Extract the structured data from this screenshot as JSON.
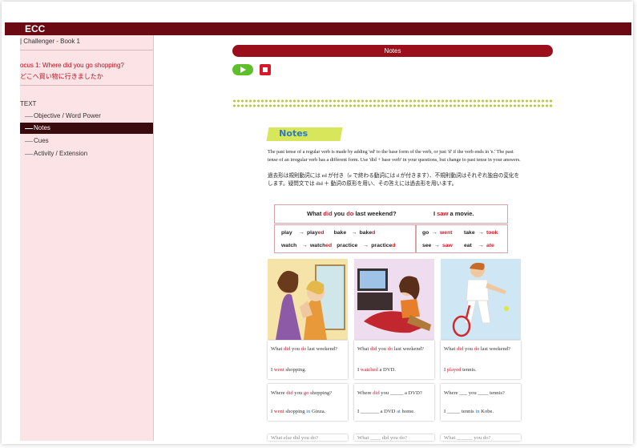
{
  "app": {
    "title": "ECC"
  },
  "sidebar": {
    "book": "| Challenger - Book 1",
    "focus_en": "ocus 1: Where did you go shopping?",
    "focus_jp": "どこへ買い物に行きましたか",
    "section": "TEXT",
    "items": [
      {
        "label": "Objective / Word Power",
        "active": false
      },
      {
        "label": "Notes",
        "active": true
      },
      {
        "label": "Cues",
        "active": false
      },
      {
        "label": "Activity / Extension",
        "active": false
      }
    ]
  },
  "main": {
    "header": "Notes",
    "play_icon": "play-icon",
    "stop_icon": "stop-icon",
    "notes_tag": "Notes",
    "para_en": "The past tense of a regular verb is made by adding 'ed' to the base form of the verb, or just 'd' if the verb ends in 'e.' The past tense of an irregular verb has a different form. Use 'did + base verb' in your questions, but change to past tense in your answers.",
    "para_jp": "過去形は規則動詞には ed が付き（e で終わる動詞には d が付きます）、不規則動詞はそれぞれ独自の変化をします。疑問文では did ＋ 動詞の原形を用い、その答えには過去形を用います。",
    "example": {
      "q_pre": "What ",
      "q_did": "did",
      " q_mid": "",
      "q_you": " you ",
      "q_do": "do",
      "q_post": " last weekend?",
      "a_pre": "I ",
      "a_saw": "saw",
      "a_post": " a movie."
    },
    "regular": [
      {
        "base": "play",
        "stem": "play",
        "suffix": "ed"
      },
      {
        "base": "bake",
        "stem": "bake",
        "suffix": "d"
      },
      {
        "base": "watch",
        "stem": "watch",
        "suffix": "ed"
      },
      {
        "base": "practice",
        "stem": "practice",
        "suffix": "d"
      }
    ],
    "irregular": [
      {
        "base": "go",
        "past": "went"
      },
      {
        "base": "take",
        "past": "took"
      },
      {
        "base": "see",
        "past": "saw"
      },
      {
        "base": "eat",
        "past": "ate"
      }
    ],
    "arrow": "→",
    "cards": [
      {
        "q1": "What ",
        "q_did": "did",
        "q2": " you ",
        "q_do": "do",
        "q3": " last weekend?",
        "a1": "I ",
        "a_verb": "went",
        "a2": " shopping."
      },
      {
        "q1": "What ",
        "q_did": "did",
        "q2": " you ",
        "q_do": "do",
        "q3": " last weekend?",
        "a1": "I ",
        "a_verb": "watched",
        "a2": " a DVD."
      },
      {
        "q1": "What ",
        "q_did": "did",
        "q2": " you ",
        "q_do": "do",
        "q3": " last weekend?",
        "a1": "I ",
        "a_verb": "played",
        "a2": " tennis."
      }
    ],
    "cards2": [
      {
        "q1": "Where ",
        "q_did": "did",
        "q2": " you ",
        "q_verb": "go",
        "q3": " shopping?",
        "a1": "I ",
        "a_verb": "went",
        "a2": " shopping ",
        "a_prep": "in",
        "a3": " Ginza."
      },
      {
        "q1": "Where ",
        "q_did": "did",
        "q2": " you _____ a DVD?",
        "a1": "I _______ a DVD ",
        "a_prep": "at",
        "a3": " home."
      },
      {
        "q1": "Where ___ you ____ tennis?",
        "a1": "I _____ tennis ",
        "a_prep": "in",
        "a3": " Kobe."
      }
    ],
    "cards3": [
      {
        "text": "What else did you do?"
      },
      {
        "text": "What ____ did you do?"
      },
      {
        "text": "What ______ you do?"
      }
    ],
    "images": [
      "shopping-illustration",
      "watching-dvd-illustration",
      "tennis-illustration"
    ]
  }
}
